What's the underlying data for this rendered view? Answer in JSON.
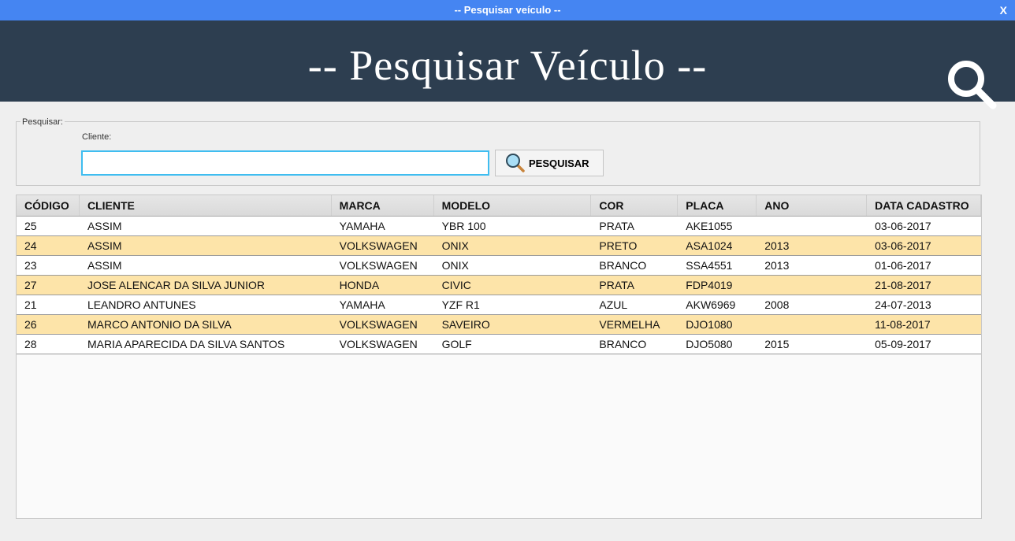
{
  "window": {
    "title": "-- Pesquisar veículo --",
    "close": "X"
  },
  "header": {
    "title": "-- Pesquisar Veículo --",
    "icon": "search-icon"
  },
  "search": {
    "group_label": "Pesquisar:",
    "field_label": "Cliente:",
    "value": "",
    "button_label": "PESQUISAR"
  },
  "table": {
    "columns": [
      "CÓDIGO",
      "CLIENTE",
      "MARCA",
      "MODELO",
      "COR",
      "PLACA",
      "ANO",
      "DATA CADASTRO"
    ],
    "rows": [
      [
        "25",
        "ASSIM",
        "YAMAHA",
        "YBR 100",
        "PRATA",
        "AKE1055",
        "",
        "03-06-2017"
      ],
      [
        "24",
        "ASSIM",
        "VOLKSWAGEN",
        "ONIX",
        "PRETO",
        "ASA1024",
        "2013",
        "03-06-2017"
      ],
      [
        "23",
        "ASSIM",
        "VOLKSWAGEN",
        "ONIX",
        "BRANCO",
        "SSA4551",
        "2013",
        "01-06-2017"
      ],
      [
        "27",
        "JOSE ALENCAR DA SILVA JUNIOR",
        "HONDA",
        "CIVIC",
        "PRATA",
        "FDP4019",
        "",
        "21-08-2017"
      ],
      [
        "21",
        "LEANDRO ANTUNES",
        "YAMAHA",
        "YZF R1",
        "AZUL",
        "AKW6969",
        "2008",
        "24-07-2013"
      ],
      [
        "26",
        "MARCO ANTONIO DA SILVA",
        "VOLKSWAGEN",
        "SAVEIRO",
        "VERMELHA",
        "DJO1080",
        "",
        "11-08-2017"
      ],
      [
        "28",
        "MARIA APARECIDA DA SILVA SANTOS",
        "VOLKSWAGEN",
        "GOLF",
        "BRANCO",
        "DJO5080",
        "2015",
        "05-09-2017"
      ]
    ]
  }
}
